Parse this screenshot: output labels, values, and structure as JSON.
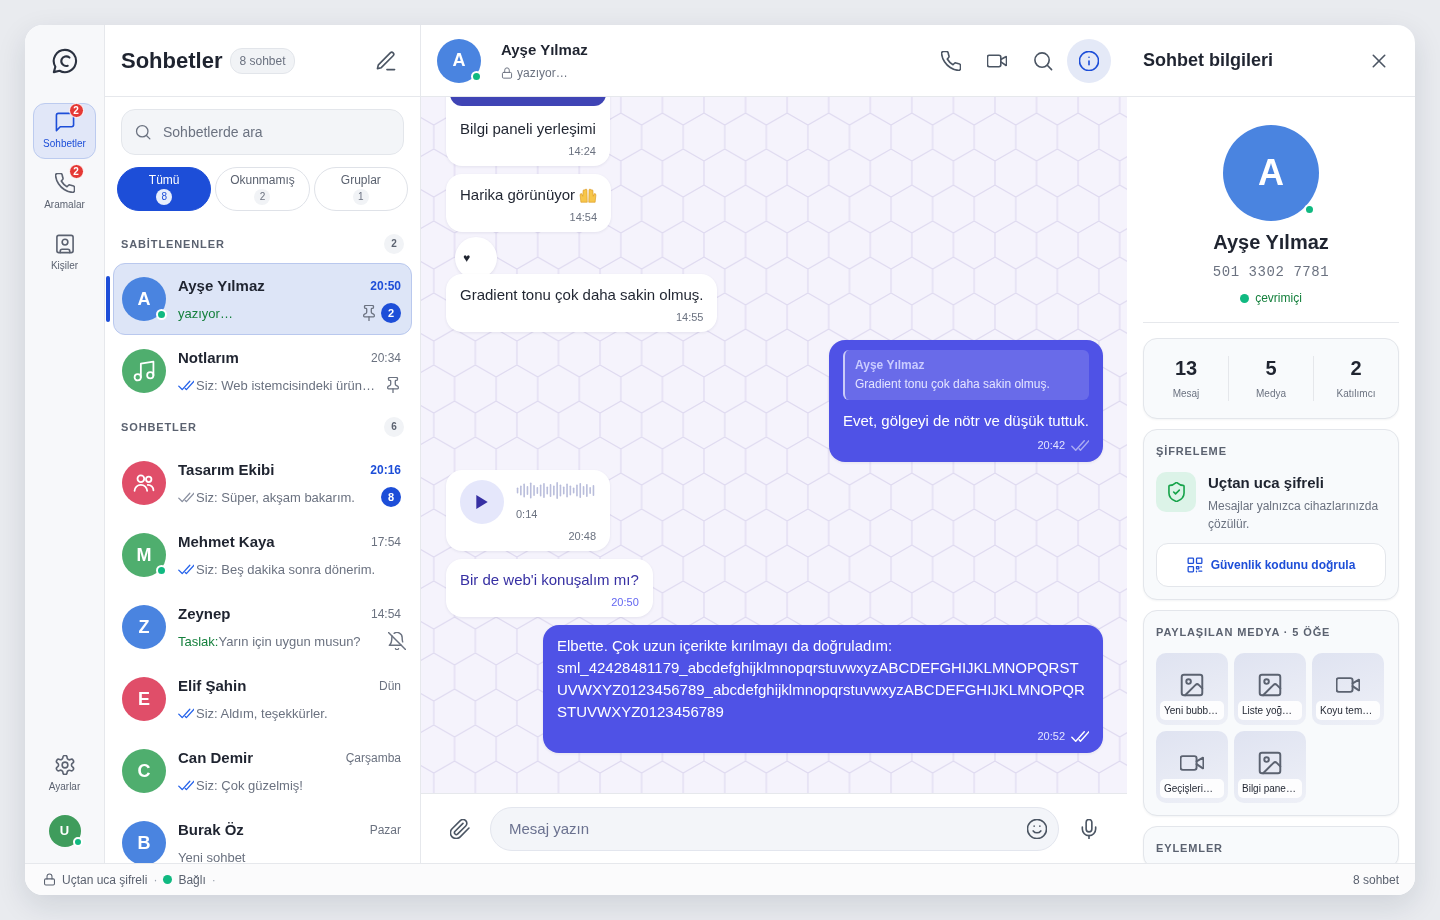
{
  "rail": {
    "items": [
      {
        "kind": "chat",
        "label": "Sohbetler",
        "badge": "2",
        "selected": true
      },
      {
        "kind": "phone",
        "label": "Aramalar",
        "badge": "2",
        "selected": false
      },
      {
        "kind": "contact",
        "label": "Kişiler",
        "selected": false
      }
    ],
    "settings": {
      "label": "Ayarlar"
    },
    "user": {
      "initial": "U",
      "online": true
    }
  },
  "chat_list": {
    "title": "Sohbetler",
    "count": "8 sohbet",
    "search": {
      "placeholder": "Sohbetlerde ara"
    },
    "filters": [
      {
        "label": "Tümü",
        "count": "8",
        "selected": true
      },
      {
        "label": "Okunmamış",
        "count": "2",
        "selected": false
      },
      {
        "label": "Gruplar",
        "count": "1",
        "selected": false
      }
    ],
    "sections": [
      {
        "title": "SABİTLENENLER",
        "count": "2",
        "chats": [
          {
            "name": "Ayşe Yılmaz",
            "time": "20:50",
            "typing": true,
            "preview": "yazıyor…",
            "avatar": {
              "kind": "letter",
              "initial": "A"
            },
            "color": "#4a84e0",
            "online": true,
            "pinned": true,
            "muted": false,
            "badge": "2",
            "selected": true
          },
          {
            "name": "Notlarım",
            "time": "20:34",
            "typing": false,
            "read": true,
            "preview": "Siz: Web istemcisindeki ürün…",
            "avatar": {
              "kind": "music"
            },
            "color": "#4fae6e",
            "online": false,
            "pinned": true,
            "muted": false,
            "selected": false
          }
        ]
      },
      {
        "title": "SOHBETLER",
        "count": "6",
        "chats": [
          {
            "name": "Tasarım Ekibi",
            "time": "20:16",
            "typing": false,
            "read": false,
            "preview": "Siz: Süper, akşam bakarım.",
            "avatar": {
              "kind": "group"
            },
            "color": "#e04e69",
            "online": false,
            "pinned": false,
            "muted": false,
            "badge": "8",
            "selected": false
          },
          {
            "name": "Mehmet Kaya",
            "time": "17:54",
            "typing": false,
            "read": true,
            "preview": "Siz: Beş dakika sonra dönerim.",
            "avatar": {
              "kind": "letter",
              "initial": "M"
            },
            "color": "#4fae6e",
            "online": true,
            "pinned": false,
            "muted": false,
            "selected": false
          },
          {
            "name": "Zeynep",
            "time": "14:54",
            "typing": false,
            "draft_label": "Taslak:",
            "preview": "Yarın için uygun musun?",
            "avatar": {
              "kind": "letter",
              "initial": "Z"
            },
            "color": "#4a84e0",
            "online": false,
            "pinned": false,
            "muted": true,
            "selected": false
          },
          {
            "name": "Elif Şahin",
            "time": "Dün",
            "typing": false,
            "read": true,
            "preview": "Siz: Aldım, teşekkürler.",
            "avatar": {
              "kind": "letter",
              "initial": "E"
            },
            "color": "#e04e69",
            "online": false,
            "pinned": false,
            "muted": false,
            "selected": false
          },
          {
            "name": "Can Demir",
            "time": "Çarşamba",
            "typing": false,
            "read": true,
            "preview": "Siz: Çok güzelmiş!",
            "avatar": {
              "kind": "letter",
              "initial": "C"
            },
            "color": "#4fae6e",
            "online": false,
            "pinned": false,
            "muted": false,
            "selected": false
          },
          {
            "name": "Burak Öz",
            "time": "Pazar",
            "typing": false,
            "preview": "Yeni sohbet",
            "avatar": {
              "kind": "letter",
              "initial": "B"
            },
            "color": "#4a84e0",
            "online": false,
            "pinned": false,
            "muted": false,
            "selected": false
          }
        ]
      }
    ]
  },
  "chat_header": {
    "initial": "A",
    "online": true,
    "name": "Ayşe Yılmaz",
    "status": "yazıyor…",
    "actions": [
      {
        "kind": "phone",
        "selected": false
      },
      {
        "kind": "video",
        "selected": false
      },
      {
        "kind": "search",
        "selected": false
      },
      {
        "kind": "info",
        "selected": true
      }
    ]
  },
  "messages": [
    {
      "outgoing": false,
      "kind": "media",
      "caption": "Bilgi paneli yerleşimi",
      "time": "14:24",
      "emoji": false,
      "unread": false
    },
    {
      "outgoing": false,
      "kind": "text",
      "text": "Harika görünüyor",
      "time": "14:54",
      "emoji": true,
      "unread": false,
      "reaction": "♥"
    },
    {
      "outgoing": false,
      "kind": "text",
      "text": "Gradient tonu çok daha sakin olmuş.",
      "time": "14:55",
      "emoji": false,
      "unread": false
    },
    {
      "outgoing": true,
      "kind": "reply",
      "quote": {
        "author": "Ayşe Yılmaz",
        "text": "Gradient tonu çok daha sakin olmuş."
      },
      "text": "Evet, gölgeyi de nötr ve düşük tuttuk.",
      "time": "20:42",
      "read": false,
      "emoji": false,
      "unread": false
    },
    {
      "outgoing": false,
      "kind": "voice",
      "duration": "0:14",
      "time": "20:48",
      "emoji": false,
      "unread": false
    },
    {
      "outgoing": false,
      "kind": "text",
      "text": "Bir de web'i konuşalım mı?",
      "time": "20:50",
      "emoji": false,
      "unread": true
    },
    {
      "outgoing": true,
      "kind": "text",
      "text": "Elbette. Çok uzun içerikte kırılmayı da doğruladım: sml_42428481179_abcdefghijklmnopqrstuvwxyzABCDEFGHIJKLMNOPQRSTUVWXYZ0123456789_abcdefghijklmnopqrstuvwxyzABCDEFGHIJKLMNOPQRSTUVWXYZ0123456789",
      "time": "20:52",
      "read": true,
      "emoji": false,
      "unread": false
    }
  ],
  "composer": {
    "placeholder": "Mesaj yazın"
  },
  "info_panel": {
    "title": "Sohbet bilgileri",
    "profile": {
      "initial": "A",
      "online": true,
      "name": "Ayşe Yılmaz",
      "phone": "501 3302 7781",
      "status": "çevrimiçi"
    },
    "stats": [
      {
        "value": "13",
        "label": "Mesaj"
      },
      {
        "value": "5",
        "label": "Medya"
      },
      {
        "value": "2",
        "label": "Katılımcı"
      }
    ],
    "encryption": {
      "heading": "ŞİFRELEME",
      "title": "Uçtan uca şifreli",
      "text": "Mesajlar yalnızca cihazlarınızda çözülür.",
      "button": "Güvenlik kodunu doğrula"
    },
    "media": {
      "heading": "PAYLAŞILAN MEDYA · 5 ÖĞE",
      "items": [
        {
          "kind": "image",
          "label": "Yeni bubb…"
        },
        {
          "kind": "image",
          "label": "Liste yoğ…"
        },
        {
          "kind": "video",
          "label": "Koyu tem…"
        },
        {
          "kind": "video",
          "label": "Geçişleri…"
        },
        {
          "kind": "image",
          "label": "Bilgi pane…"
        }
      ]
    },
    "actions": {
      "heading": "EYLEMLER"
    }
  },
  "status_bar": {
    "items": [
      {
        "kind": "lock",
        "text": "Uçtan uca şifreli"
      },
      {
        "kind": "separator",
        "text": "·"
      },
      {
        "kind": "connection",
        "text": "Bağlı",
        "connected": true
      },
      {
        "kind": "separator",
        "text": "·"
      }
    ],
    "count": "8 sohbet"
  }
}
